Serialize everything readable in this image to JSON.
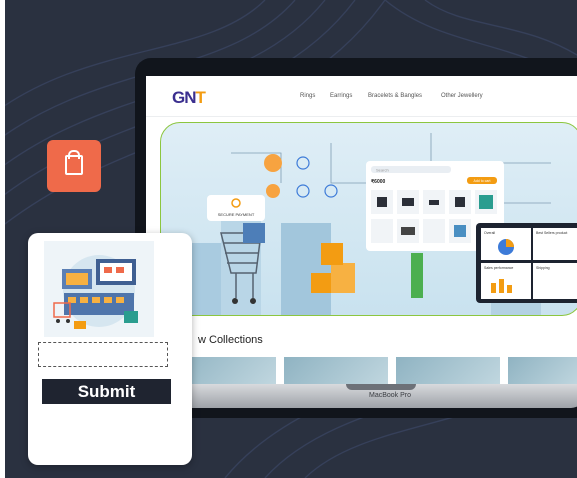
{
  "site": {
    "logo": {
      "main": "GN",
      "accent": "T"
    },
    "nav_links": [
      "Rings",
      "Earrings",
      "Bracelets & Bangles",
      "Other Jewellery"
    ],
    "hero": {
      "badge": "SECURE PAYMENT",
      "search_placeholder": "Search",
      "price": "₹6000",
      "add_button": "Add to cart",
      "cards": [
        "Overall",
        "Best Sellers product",
        "Sales performance",
        "Shipping"
      ]
    },
    "section_title": "w Collections"
  },
  "laptop": {
    "model_label": "MacBook Pro"
  },
  "card": {
    "input_value": "",
    "submit_label": "Submit"
  },
  "colors": {
    "background": "#2a3140",
    "accent_orange": "#ef6a4a",
    "hero_border": "#8cc63f"
  }
}
